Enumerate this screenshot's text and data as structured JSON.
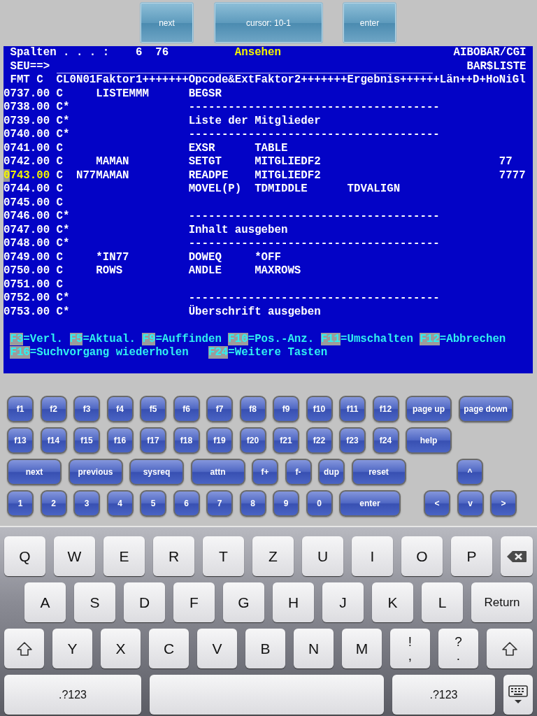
{
  "toolbar": [
    {
      "label": "next"
    },
    {
      "label": "cursor: 10-1"
    },
    {
      "label": "enter"
    }
  ],
  "terminal": {
    "header": {
      "columns_label": "Spalten . . . :",
      "columns_value": "6  76",
      "mode": "Ansehen",
      "library": "AIBOBAR/CGI",
      "prompt": "SEU==>",
      "member": "BAR$LISTE",
      "format": "FMT C",
      "ruler": "CL0N01Faktor1+++++++Opcode&ExtFaktor2+++++++Ergebnis++++++Län++D+HoNiGl"
    },
    "rows": [
      {
        "seq": "0737.00",
        "text": "C     LISTEMMM      BEGSR",
        "cursor": false
      },
      {
        "seq": "0738.00",
        "text": "C*                  --------------------------------------",
        "cursor": false
      },
      {
        "seq": "0739.00",
        "text": "C*                  Liste der Mitglieder",
        "cursor": false
      },
      {
        "seq": "0740.00",
        "text": "C*                  --------------------------------------",
        "cursor": false
      },
      {
        "seq": "0741.00",
        "text": "C                   EXSR      TABLE",
        "cursor": false
      },
      {
        "seq": "0742.00",
        "text": "C     MAMAN         SETGT     MITGLIEDF2                           77",
        "cursor": false
      },
      {
        "seq": "0743.00",
        "text": "C  N77MAMAN         READPE    MITGLIEDF2                           7777",
        "cursor": true
      },
      {
        "seq": "0744.00",
        "text": "C                   MOVEL(P)  TDMIDDLE      TDVALIGN",
        "cursor": false
      },
      {
        "seq": "0745.00",
        "text": "C",
        "cursor": false
      },
      {
        "seq": "0746.00",
        "text": "C*                  --------------------------------------",
        "cursor": false
      },
      {
        "seq": "0747.00",
        "text": "C*                  Inhalt ausgeben",
        "cursor": false
      },
      {
        "seq": "0748.00",
        "text": "C*                  --------------------------------------",
        "cursor": false
      },
      {
        "seq": "0749.00",
        "text": "C     *IN77         DOWEQ     *OFF",
        "cursor": false
      },
      {
        "seq": "0750.00",
        "text": "C     ROWS          ANDLE     MAXROWS",
        "cursor": false
      },
      {
        "seq": "0751.00",
        "text": "C",
        "cursor": false
      },
      {
        "seq": "0752.00",
        "text": "C*                  --------------------------------------",
        "cursor": false
      },
      {
        "seq": "0753.00",
        "text": "C*                  Überschrift ausgeben",
        "cursor": false
      }
    ],
    "function_keys": [
      [
        {
          "key": "F3",
          "label": "=Verl."
        },
        {
          "key": "F5",
          "label": "=Aktual."
        },
        {
          "key": "F9",
          "label": "=Auffinden"
        },
        {
          "key": "F10",
          "label": "=Pos.-Anz."
        },
        {
          "key": "F11",
          "label": "=Umschalten"
        },
        {
          "key": "F12",
          "label": "=Abbrechen"
        }
      ],
      [
        {
          "key": "F16",
          "label": "=Suchvorgang wiederholen"
        },
        {
          "key": "F24",
          "label": "=Weitere Tasten"
        }
      ]
    ]
  },
  "keypad": [
    {
      "left": [
        {
          "label": "f1",
          "kind": "small"
        },
        {
          "label": "f2",
          "kind": "small"
        },
        {
          "label": "f3",
          "kind": "small"
        },
        {
          "label": "f4",
          "kind": "small"
        },
        {
          "label": "f5",
          "kind": "small"
        },
        {
          "label": "f6",
          "kind": "small"
        },
        {
          "label": "f7",
          "kind": "small"
        },
        {
          "label": "f8",
          "kind": "small"
        },
        {
          "label": "f9",
          "kind": "small"
        },
        {
          "label": "f10",
          "kind": "small"
        },
        {
          "label": "f11",
          "kind": "small"
        },
        {
          "label": "f12",
          "kind": "small"
        },
        {
          "label": "page up",
          "kind": "medium"
        },
        {
          "label": "page down",
          "kind": "large"
        }
      ]
    },
    {
      "left": [
        {
          "label": "f13",
          "kind": "small"
        },
        {
          "label": "f14",
          "kind": "small"
        },
        {
          "label": "f15",
          "kind": "small"
        },
        {
          "label": "f16",
          "kind": "small"
        },
        {
          "label": "f17",
          "kind": "small"
        },
        {
          "label": "f18",
          "kind": "small"
        },
        {
          "label": "f19",
          "kind": "small"
        },
        {
          "label": "f20",
          "kind": "small"
        },
        {
          "label": "f21",
          "kind": "small"
        },
        {
          "label": "f22",
          "kind": "small"
        },
        {
          "label": "f23",
          "kind": "small"
        },
        {
          "label": "f24",
          "kind": "small"
        },
        {
          "label": "help",
          "kind": "medium"
        }
      ]
    },
    {
      "left": [
        {
          "label": "next",
          "kind": "large"
        },
        {
          "label": "previous",
          "kind": "large"
        },
        {
          "label": "sysreq",
          "kind": "large"
        },
        {
          "label": "attn",
          "kind": "large"
        },
        {
          "label": "f+",
          "kind": "small"
        },
        {
          "label": "f-",
          "kind": "small"
        },
        {
          "label": "dup",
          "kind": "small"
        },
        {
          "label": "reset",
          "kind": "large"
        }
      ],
      "right": [
        {
          "label": "^",
          "kind": "small"
        }
      ]
    },
    {
      "left": [
        {
          "label": "1",
          "kind": "small"
        },
        {
          "label": "2",
          "kind": "small"
        },
        {
          "label": "3",
          "kind": "small"
        },
        {
          "label": "4",
          "kind": "small"
        },
        {
          "label": "5",
          "kind": "small"
        },
        {
          "label": "6",
          "kind": "small"
        },
        {
          "label": "7",
          "kind": "small"
        },
        {
          "label": "8",
          "kind": "small"
        },
        {
          "label": "9",
          "kind": "small"
        },
        {
          "label": "0",
          "kind": "small"
        },
        {
          "label": "enter",
          "kind": "xlarge"
        }
      ],
      "right": [
        {
          "label": "<",
          "kind": "small"
        },
        {
          "label": "v",
          "kind": "small"
        },
        {
          "label": ">",
          "kind": "small"
        }
      ]
    }
  ],
  "keyboard": [
    [
      {
        "kind": "letter",
        "label": "Q"
      },
      {
        "kind": "letter",
        "label": "W"
      },
      {
        "kind": "letter",
        "label": "E"
      },
      {
        "kind": "letter",
        "label": "R"
      },
      {
        "kind": "letter",
        "label": "T"
      },
      {
        "kind": "letter",
        "label": "Z"
      },
      {
        "kind": "letter",
        "label": "U"
      },
      {
        "kind": "letter",
        "label": "I"
      },
      {
        "kind": "letter",
        "label": "O"
      },
      {
        "kind": "letter",
        "label": "P"
      },
      {
        "kind": "backspace"
      }
    ],
    [
      {
        "kind": "letter",
        "label": "A"
      },
      {
        "kind": "letter",
        "label": "S"
      },
      {
        "kind": "letter",
        "label": "D"
      },
      {
        "kind": "letter",
        "label": "F"
      },
      {
        "kind": "letter",
        "label": "G"
      },
      {
        "kind": "letter",
        "label": "H"
      },
      {
        "kind": "letter",
        "label": "J"
      },
      {
        "kind": "letter",
        "label": "K"
      },
      {
        "kind": "letter",
        "label": "L"
      },
      {
        "kind": "return",
        "label": "Return"
      }
    ],
    [
      {
        "kind": "shift"
      },
      {
        "kind": "letter",
        "label": "Y"
      },
      {
        "kind": "letter",
        "label": "X"
      },
      {
        "kind": "letter",
        "label": "C"
      },
      {
        "kind": "letter",
        "label": "V"
      },
      {
        "kind": "letter",
        "label": "B"
      },
      {
        "kind": "letter",
        "label": "N"
      },
      {
        "kind": "letter",
        "label": "M"
      },
      {
        "kind": "dual",
        "label": "!",
        "sub": ","
      },
      {
        "kind": "dual",
        "label": "?",
        "sub": "."
      },
      {
        "kind": "shift"
      }
    ],
    [
      {
        "kind": "mode",
        "label": ".?123"
      },
      {
        "kind": "space"
      },
      {
        "kind": "mode2",
        "label": ".?123"
      },
      {
        "kind": "hide"
      }
    ]
  ]
}
